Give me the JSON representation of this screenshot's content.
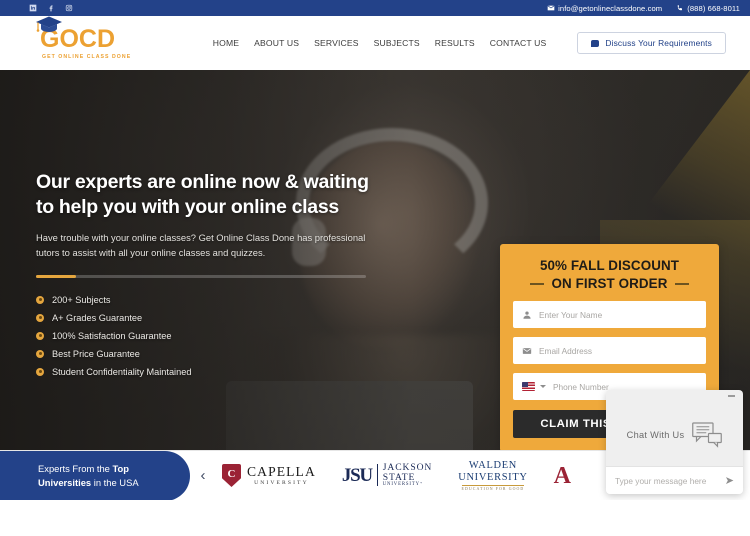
{
  "topbar": {
    "social": [
      {
        "name": "linkedin-icon",
        "label": "LinkedIn"
      },
      {
        "name": "facebook-icon",
        "label": "Facebook"
      },
      {
        "name": "instagram-icon",
        "label": "Instagram"
      }
    ],
    "email": "info@getonlineclassdone.com",
    "phone": "(888) 668-8011"
  },
  "header": {
    "logo_word": "GOCD",
    "logo_tagline": "GET ONLINE CLASS DONE",
    "nav": [
      {
        "label": "HOME"
      },
      {
        "label": "ABOUT US"
      },
      {
        "label": "SERVICES"
      },
      {
        "label": "SUBJECTS"
      },
      {
        "label": "RESULTS"
      },
      {
        "label": "CONTACT US"
      }
    ],
    "cta_label": "Discuss Your Requirements"
  },
  "hero": {
    "title_line1": "Our experts are online now & waiting",
    "title_line2": "to help you with your online class",
    "subtitle": "Have trouble with your online classes? Get Online Class Done has professional tutors to assist with all your online classes and quizzes.",
    "bullets": [
      {
        "label": "200+ Subjects"
      },
      {
        "label": "A+ Grades Guarantee"
      },
      {
        "label": "100% Satisfaction Guarantee"
      },
      {
        "label": "Best Price Guarantee"
      },
      {
        "label": "Student Confidentiality Maintained"
      }
    ]
  },
  "form": {
    "title_line1": "50% FALL DISCOUNT",
    "title_line2": "ON FIRST ORDER",
    "name_placeholder": "Enter Your Name",
    "email_placeholder": "Email Address",
    "phone_placeholder": "Phone Number",
    "phone_country": "US",
    "submit_label": "CLAIM THIS DISCOUNT"
  },
  "universities": {
    "banner_prefix": "Experts From the ",
    "banner_bold1": "Top",
    "banner_bold2": "Universities",
    "banner_suffix": " in the USA",
    "logos": [
      {
        "name": "Capella",
        "line1": "CAPELLA",
        "line2": "UNIVERSITY",
        "mark": "C"
      },
      {
        "name": "Jackson State",
        "mark": "JSU",
        "line1": "JACKSON",
        "line2": "STATE",
        "line3": "UNIVERSITY⁺"
      },
      {
        "name": "Walden",
        "line1": "WALDEN",
        "line2": "UNIVERSITY",
        "line3": "EDUCATION FOR GOOD"
      },
      {
        "name": "Partial logo",
        "mark": "A"
      }
    ]
  },
  "chat": {
    "title": "Chat With Us",
    "input_placeholder": "Type your message here"
  },
  "colors": {
    "brand_blue": "#234289",
    "brand_orange": "#EFA93B",
    "logo_gold": "#ECA132",
    "dark_button": "#2B2B2B",
    "capella_red": "#9B2335"
  }
}
